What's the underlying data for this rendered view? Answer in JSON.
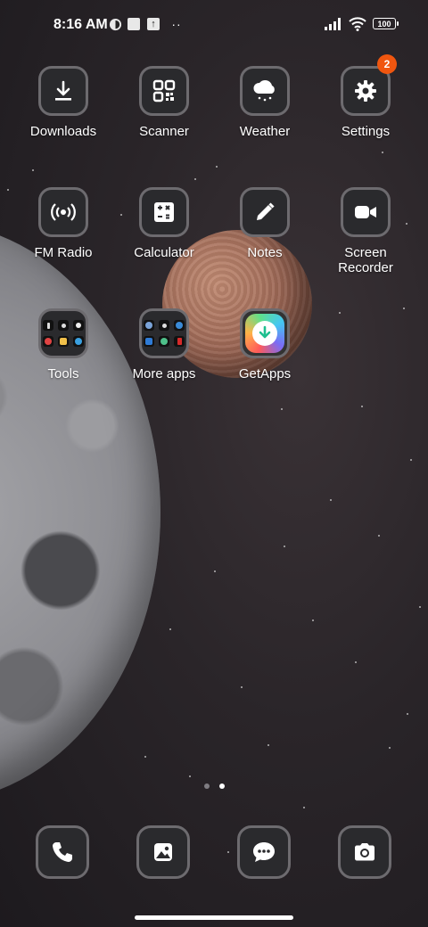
{
  "status_bar": {
    "time": "8:16 AM",
    "battery": "100",
    "icons": [
      "vpn-shield-icon",
      "square-notification-icon",
      "upload-icon",
      "more-dots-icon",
      "signal-icon",
      "wifi-icon",
      "battery-icon"
    ]
  },
  "apps": [
    {
      "label": "Downloads",
      "icon": "download-icon"
    },
    {
      "label": "Scanner",
      "icon": "qr-scanner-icon"
    },
    {
      "label": "Weather",
      "icon": "cloud-rain-icon"
    },
    {
      "label": "Settings",
      "icon": "gear-icon",
      "badge": "2"
    },
    {
      "label": "FM Radio",
      "icon": "radio-icon"
    },
    {
      "label": "Calculator",
      "icon": "calculator-icon"
    },
    {
      "label": "Notes",
      "icon": "pencil-icon"
    },
    {
      "label": "Screen Recorder",
      "icon": "video-camera-icon"
    },
    {
      "label": "Tools",
      "icon": "folder-icon"
    },
    {
      "label": "More apps",
      "icon": "folder-icon"
    },
    {
      "label": "GetApps",
      "icon": "getapps-icon"
    }
  ],
  "page_indicator": {
    "pages": 2,
    "active": 2
  },
  "dock": [
    {
      "name": "Phone",
      "icon": "phone-icon"
    },
    {
      "name": "Gallery",
      "icon": "gallery-icon"
    },
    {
      "name": "Messages",
      "icon": "chat-icon"
    },
    {
      "name": "Camera",
      "icon": "camera-icon"
    }
  ],
  "colors": {
    "badge": "#f0560f",
    "tile_border": "#6d6b6f"
  }
}
